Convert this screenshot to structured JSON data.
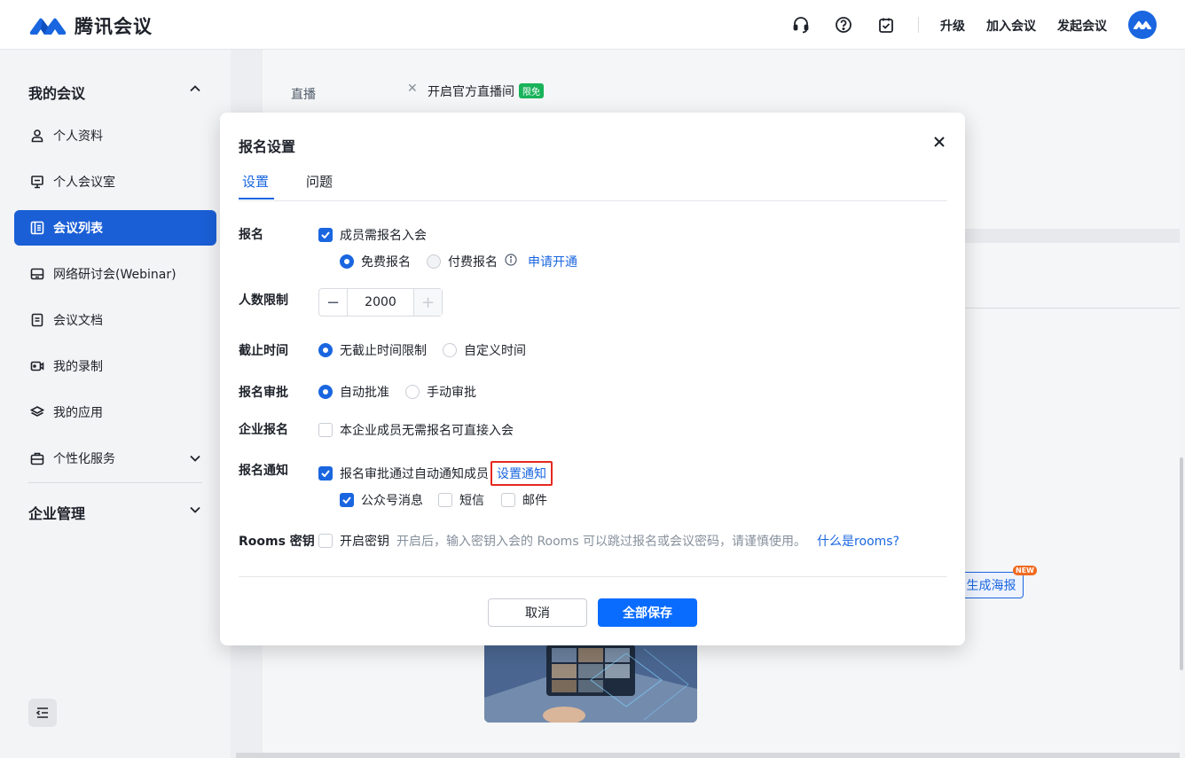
{
  "app": {
    "name": "腾讯会议",
    "brand_color": "#1a66e0"
  },
  "topbar": {
    "icons": [
      "headset-icon",
      "help-icon",
      "checklist-icon"
    ],
    "upgrade": "升级",
    "join": "加入会议",
    "start": "发起会议"
  },
  "sidebar": {
    "my_meetings": "我的会议",
    "items": [
      {
        "label": "个人资料",
        "icon": "user-icon"
      },
      {
        "label": "个人会议室",
        "icon": "monitor-icon"
      },
      {
        "label": "会议列表",
        "icon": "list-icon",
        "active": true
      },
      {
        "label": "网络研讨会(Webinar)",
        "icon": "webinar-icon"
      },
      {
        "label": "会议文档",
        "icon": "document-icon"
      },
      {
        "label": "我的录制",
        "icon": "video-icon"
      },
      {
        "label": "我的应用",
        "icon": "layers-icon"
      },
      {
        "label": "个性化服务",
        "icon": "briefcase-icon"
      }
    ],
    "enterprise": "企业管理"
  },
  "background": {
    "live_label": "直播",
    "live_option": "开启官方直播间",
    "live_badge": "限免",
    "poster_button": "生成海报",
    "new_badge": "NEW"
  },
  "modal": {
    "title": "报名设置",
    "tabs": [
      "设置",
      "问题"
    ],
    "registration": {
      "label": "报名",
      "require": "成员需报名入会",
      "free": "免费报名",
      "paid": "付费报名",
      "apply": "申请开通"
    },
    "limit": {
      "label": "人数限制",
      "value": "2000"
    },
    "deadline": {
      "label": "截止时间",
      "none": "无截止时间限制",
      "custom": "自定义时间"
    },
    "approval": {
      "label": "报名审批",
      "auto": "自动批准",
      "manual": "手动审批"
    },
    "enterprise": {
      "label": "企业报名",
      "option": "本企业成员无需报名可直接入会"
    },
    "notify": {
      "label": "报名通知",
      "option": "报名审批通过自动通知成员",
      "set_link": "设置通知",
      "wechat": "公众号消息",
      "sms": "短信",
      "email": "邮件"
    },
    "rooms": {
      "label": "Rooms 密钥",
      "option": "开启密钥",
      "hint": "开启后，输入密钥入会的 Rooms 可以跳过报名或会议密码，请谨慎使用。",
      "link": "什么是rooms?"
    },
    "cancel": "取消",
    "save": "全部保存"
  }
}
